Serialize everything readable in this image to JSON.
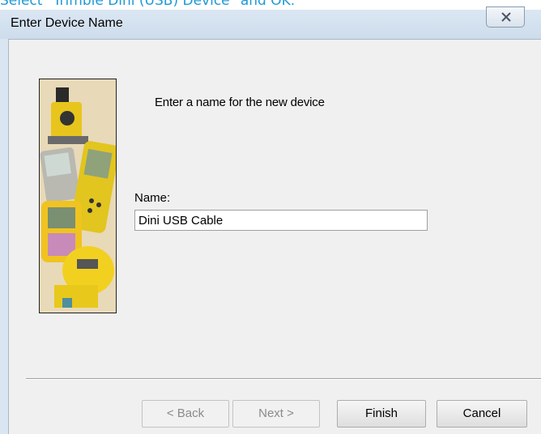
{
  "page_caption": "Select \"Trimble Dini (USB) Device\" and OK.",
  "window": {
    "title": "Enter Device Name"
  },
  "dialog": {
    "prompt": "Enter a name for the new device",
    "name_label": "Name:",
    "name_value": "Dini USB Cable"
  },
  "buttons": {
    "back": "< Back",
    "next": "Next >",
    "finish": "Finish",
    "cancel": "Cancel"
  },
  "colors": {
    "caption": "#1f9ad6",
    "titlebar": "#d9e5f1",
    "dialog_bg": "#f0f0f0"
  }
}
